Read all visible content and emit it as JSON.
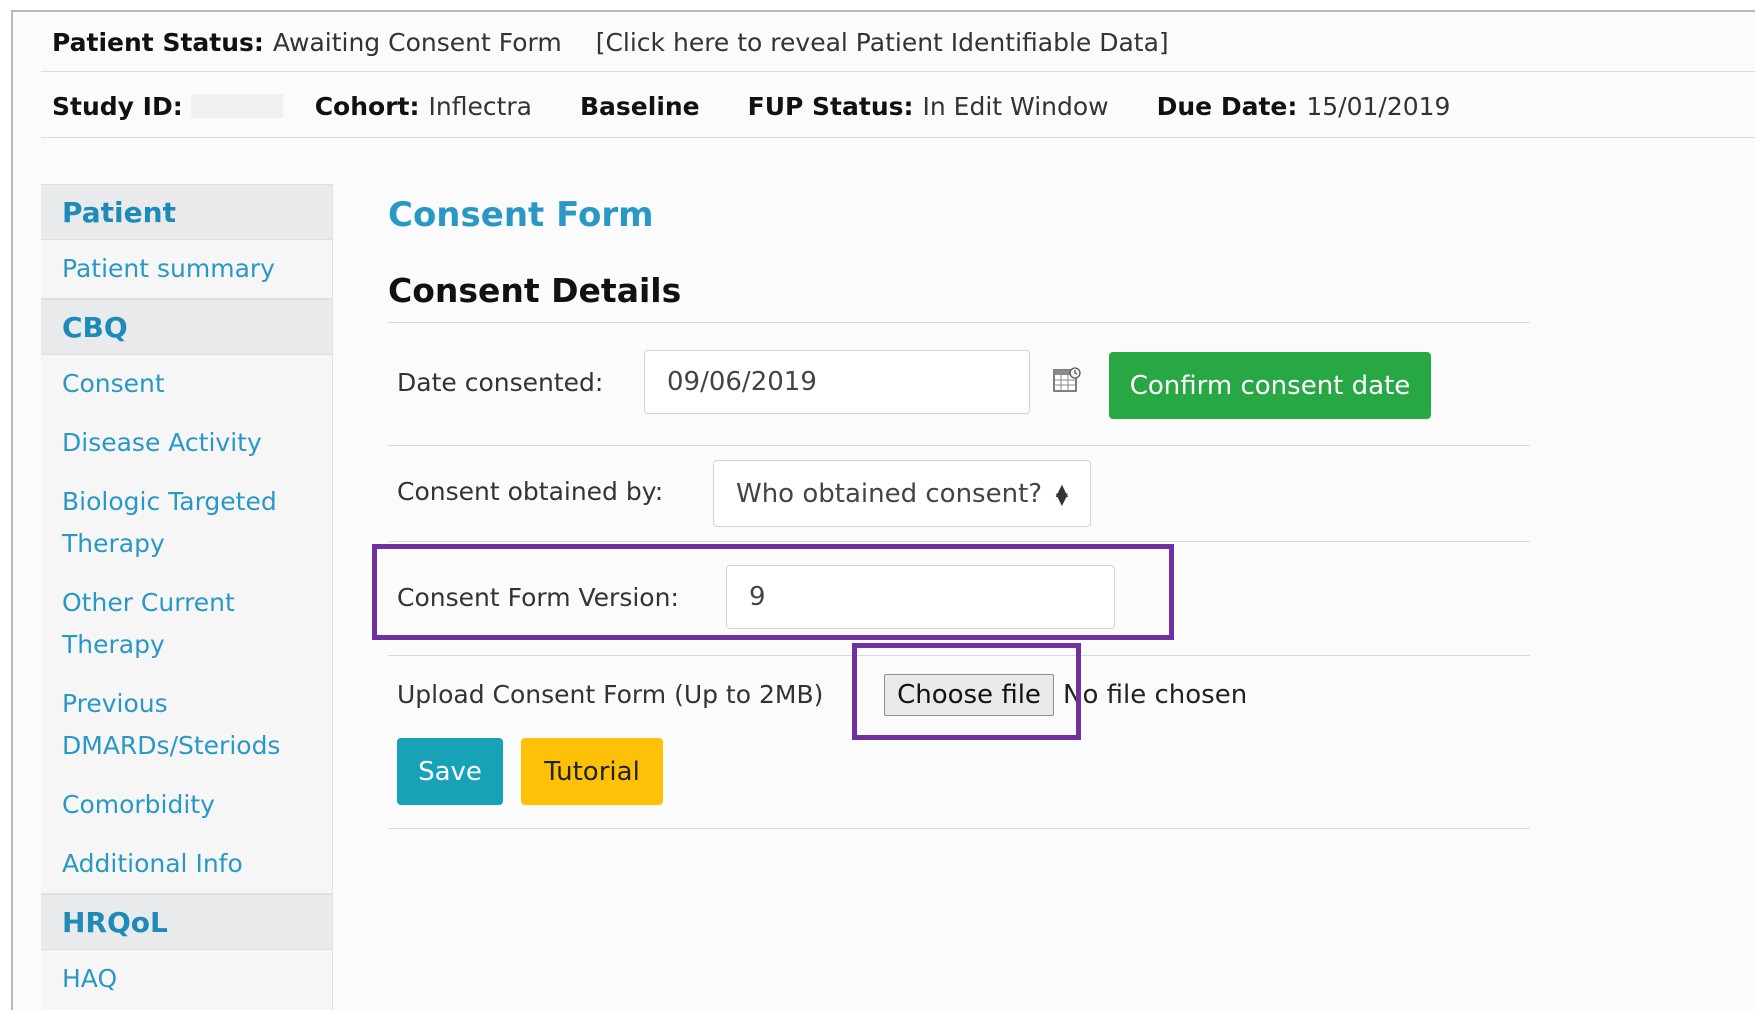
{
  "header": {
    "patient_status_label": "Patient Status:",
    "patient_status_value": "Awaiting Consent Form",
    "reveal_link": "[Click here to reveal Patient Identifiable Data]",
    "study_id_label": "Study ID:",
    "cohort_label": "Cohort:",
    "cohort_value": "Inflectra",
    "baseline": "Baseline",
    "fup_status_label": "FUP Status:",
    "fup_status_value": "In Edit Window",
    "due_date_label": "Due Date:",
    "due_date_value": "15/01/2019"
  },
  "sidebar": {
    "sections": [
      {
        "title": "Patient",
        "items": [
          "Patient summary"
        ]
      },
      {
        "title": "CBQ",
        "items": [
          "Consent",
          "Disease Activity",
          "Biologic Targeted Therapy",
          "Other Current Therapy",
          "Previous DMARDs/Steriods",
          "Comorbidity",
          "Additional Info"
        ]
      },
      {
        "title": "HRQoL",
        "items": [
          "HAQ"
        ]
      }
    ]
  },
  "main": {
    "title": "Consent Form",
    "subtitle": "Consent Details",
    "date_label": "Date consented:",
    "date_value": "09/06/2019",
    "confirm_button": "Confirm consent date",
    "obtained_label": "Consent obtained by:",
    "obtained_select": "Who obtained consent?",
    "version_label": "Consent Form Version:",
    "version_value": "9",
    "upload_label": "Upload Consent Form (Up to 2MB)",
    "choose_file": "Choose file",
    "no_file": "No file chosen",
    "save_button": "Save",
    "tutorial_button": "Tutorial"
  },
  "colors": {
    "link": "#2a98c6",
    "confirm": "#27a845",
    "save": "#17a2b8",
    "tutorial": "#ffc107",
    "highlight": "#7030a0"
  }
}
